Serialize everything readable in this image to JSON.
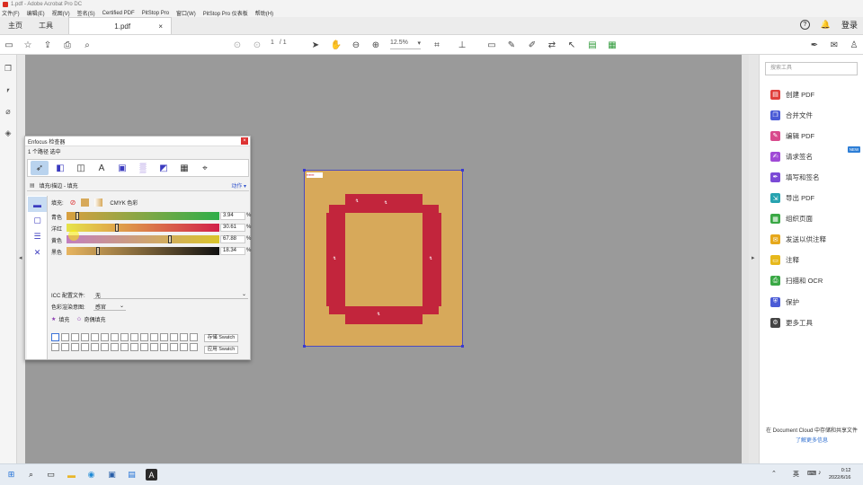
{
  "window": {
    "title": "1.pdf - Adobe Acrobat Pro DC"
  },
  "menu": [
    "文件(F)",
    "编辑(E)",
    "视图(V)",
    "签名(S)",
    "Certified PDF",
    "PitStop Pro",
    "窗口(W)",
    "PitStop Pro 仪表板",
    "帮助(H)"
  ],
  "tabs": {
    "home": "主页",
    "tools": "工具",
    "doc": "1.pdf",
    "close": "×",
    "help": "?",
    "bell": "🔔",
    "login": "登录"
  },
  "toolbar": {
    "page_current": "1",
    "page_total": "/ 1",
    "zoom": "12.5%",
    "zoom_arrow": "▾"
  },
  "page_content": {
    "mini_label": "▪▪▪▪▪▪",
    "marks": [
      "↯",
      "↯",
      "↯",
      "↯",
      "↯"
    ]
  },
  "panel": {
    "title": "Enfocus 检查器",
    "close": "×",
    "selection": "1 个路径 选中",
    "fill_header": "填充/描边 - 填充",
    "fill_action": "动作 ▾",
    "fill_label": "填充:",
    "colorspace": "CMYK 色彩",
    "channels": [
      {
        "label": "青色",
        "value": "3.94",
        "level": 0.04,
        "pct": "%"
      },
      {
        "label": "洋红",
        "value": "30.61",
        "level": 0.31,
        "pct": "%"
      },
      {
        "label": "黄色",
        "value": "67.88",
        "level": 0.68,
        "pct": "%"
      },
      {
        "label": "黑色",
        "value": "18.34",
        "level": 0.18,
        "pct": "%"
      }
    ],
    "icc_label": "ICC 配置文件:",
    "icc_value": "无",
    "intent_label": "色彩渲染意图:",
    "intent_value": "感官",
    "fill_button": "填充",
    "oddeven_button": "奇偶填充",
    "save_swatch": "存储 Swatch",
    "apply_swatch": "应用 Swatch"
  },
  "right_panel": {
    "search_placeholder": "搜索工具",
    "new_badge": "NEW",
    "tools": [
      {
        "label": "创建 PDF",
        "icon": "create-pdf-icon",
        "color": "#e0403c"
      },
      {
        "label": "合并文件",
        "icon": "combine-files-icon",
        "color": "#4a5bd6"
      },
      {
        "label": "编辑 PDF",
        "icon": "edit-pdf-icon",
        "color": "#d84a8c"
      },
      {
        "label": "请求签名",
        "icon": "request-signature-icon",
        "color": "#a04ad6"
      },
      {
        "label": "填写和签名",
        "icon": "fill-sign-icon",
        "color": "#7b4ad6"
      },
      {
        "label": "导出 PDF",
        "icon": "export-pdf-icon",
        "color": "#27a3b0"
      },
      {
        "label": "组织页面",
        "icon": "organize-pages-icon",
        "color": "#3aa845"
      },
      {
        "label": "发送以供注释",
        "icon": "send-comment-icon",
        "color": "#e6a81c"
      },
      {
        "label": "注释",
        "icon": "comment-icon",
        "color": "#e6b81c"
      },
      {
        "label": "扫描和 OCR",
        "icon": "scan-ocr-icon",
        "color": "#3aa845"
      },
      {
        "label": "保护",
        "icon": "protect-icon",
        "color": "#4a5bd6"
      },
      {
        "label": "更多工具",
        "icon": "more-tools-icon",
        "color": "#444444"
      }
    ],
    "footer_text": "在 Document Cloud 中存储和共享文件",
    "footer_link": "了解更多信息"
  },
  "taskbar": {
    "ime": "英",
    "time": "0:12",
    "date": "2022/6/16"
  }
}
